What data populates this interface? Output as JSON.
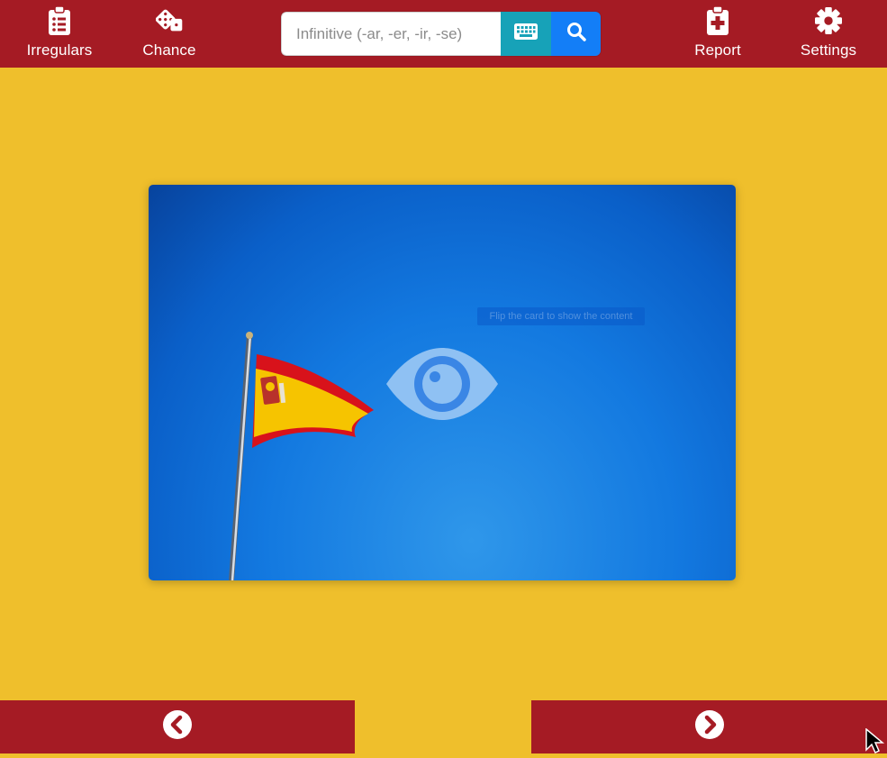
{
  "nav": {
    "irregulars_label": "Irregulars",
    "chance_label": "Chance",
    "report_label": "Report",
    "settings_label": "Settings",
    "icons": [
      "clipboard-list-icon",
      "dice-icon",
      "clipboard-medical-icon",
      "gear-icon"
    ]
  },
  "search": {
    "placeholder": "Infinitive (-ar, -er, -ir, -se)",
    "value": "",
    "keyboard_icon": "keyboard-icon",
    "search_icon": "search-icon"
  },
  "card": {
    "tooltip": "Flip the card to show the content",
    "image": "spanish-flag-on-pole",
    "eye_icon": "eye-icon"
  },
  "footer": {
    "prev_icon": "chevron-circle-left-icon",
    "next_icon": "chevron-circle-right-icon"
  },
  "colors": {
    "header": "#a51b24",
    "background": "#efbf2c",
    "keyboard_button": "#17a2b8",
    "search_button": "#137ef7",
    "card_blue": "#1379e0"
  }
}
